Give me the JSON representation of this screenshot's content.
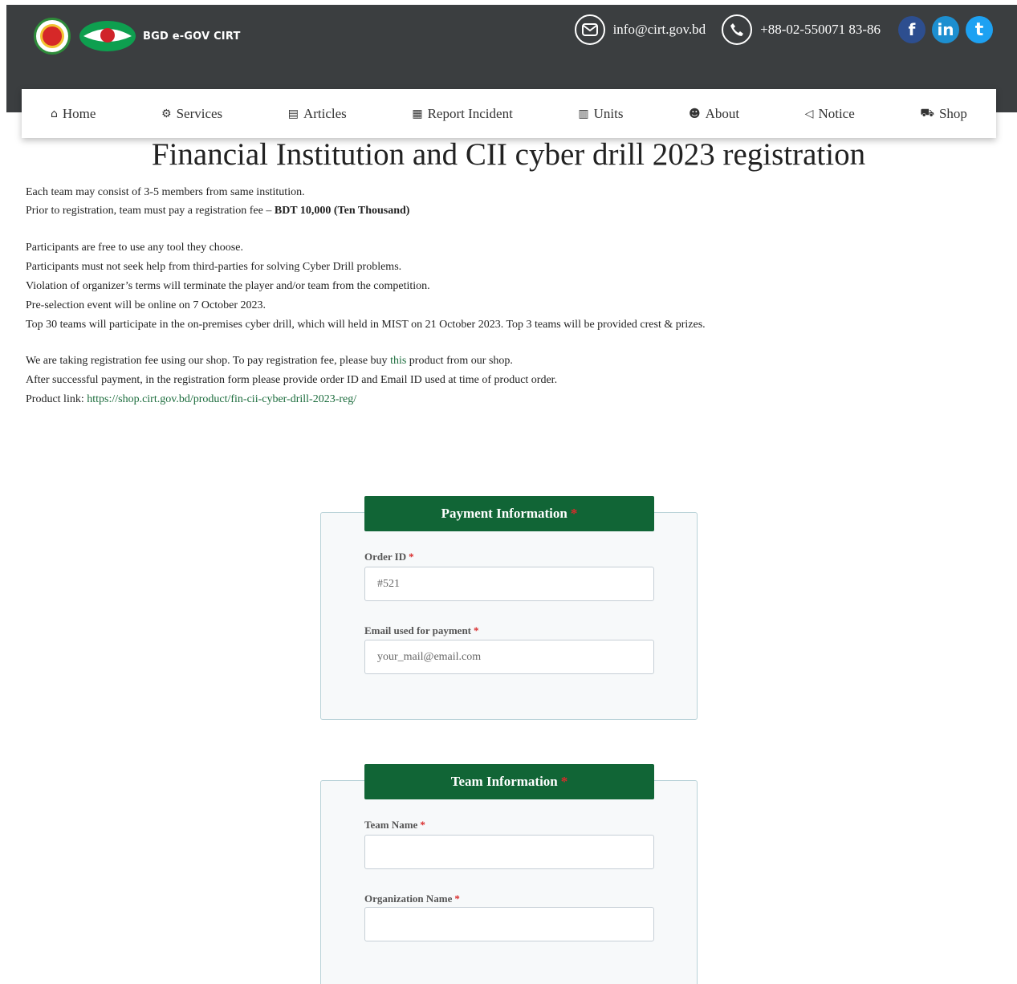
{
  "header": {
    "brand": "BGD e-GOV CIRT",
    "email": "info@cirt.gov.bd",
    "phone": "+88-02-550071 83-86",
    "social": [
      {
        "name": "facebook-icon",
        "glyph": "f"
      },
      {
        "name": "linkedin-icon",
        "glyph": "in"
      },
      {
        "name": "twitter-icon",
        "glyph": "t"
      }
    ]
  },
  "nav": {
    "items": [
      {
        "label": "Home",
        "icon": "home-icon",
        "glyph": "⌂"
      },
      {
        "label": "Services",
        "icon": "gears-icon",
        "glyph": "⚙"
      },
      {
        "label": "Articles",
        "icon": "newspaper-icon",
        "glyph": "▤"
      },
      {
        "label": "Report Incident",
        "icon": "file-text-icon",
        "glyph": "▦"
      },
      {
        "label": "Units",
        "icon": "building-icon",
        "glyph": "▥"
      },
      {
        "label": "About",
        "icon": "users-icon",
        "glyph": "☻"
      },
      {
        "label": "Notice",
        "icon": "bullhorn-icon",
        "glyph": "◁"
      },
      {
        "label": "Shop",
        "icon": "cart-icon",
        "glyph": "⛟"
      }
    ]
  },
  "page": {
    "title": "Financial Institution and CII cyber drill 2023 registration",
    "lines": [
      "Each team may consist of 3-5 members from same institution.",
      "Prior to registration, team must pay a registration fee – ",
      "Participants are free to use any tool they choose.",
      "Participants must not seek help from third-parties for solving Cyber Drill problems.",
      "Violation of organizer’s terms will terminate the player and/or team from the competition.",
      "Pre-selection event will be online on 7 October 2023.",
      "Top 30 teams will participate in the on-premises cyber drill, which will held in MIST on 21 October 2023. Top 3 teams will be provided crest & prizes."
    ],
    "fee_bold": "BDT 10,000 (Ten Thousand)",
    "shop_line_pre": "We are taking registration fee using our shop. To pay registration fee, please buy ",
    "shop_link": "this",
    "shop_line_post": " product from our shop.",
    "after_payment": "After successful payment, in the registration form please provide order ID and Email ID used at time of product order.",
    "product_link_label": "Product link: ",
    "product_link": "https://shop.cirt.gov.bd/product/fin-cii-cyber-drill-2023-reg/"
  },
  "form": {
    "required_mark": "*",
    "payment": {
      "legend": "Payment Information",
      "order_id_label": "Order ID",
      "order_id_placeholder": "#521",
      "email_label": "Email used for payment",
      "email_placeholder": "your_mail@email.com"
    },
    "team": {
      "legend": "Team Information",
      "team_name_label": "Team Name",
      "team_name_placeholder": "",
      "org_name_label": "Organization Name",
      "org_name_placeholder": ""
    }
  },
  "colors": {
    "header_bg": "#3b3e40",
    "accent_green": "#116536",
    "required_red": "#d92b2b"
  }
}
